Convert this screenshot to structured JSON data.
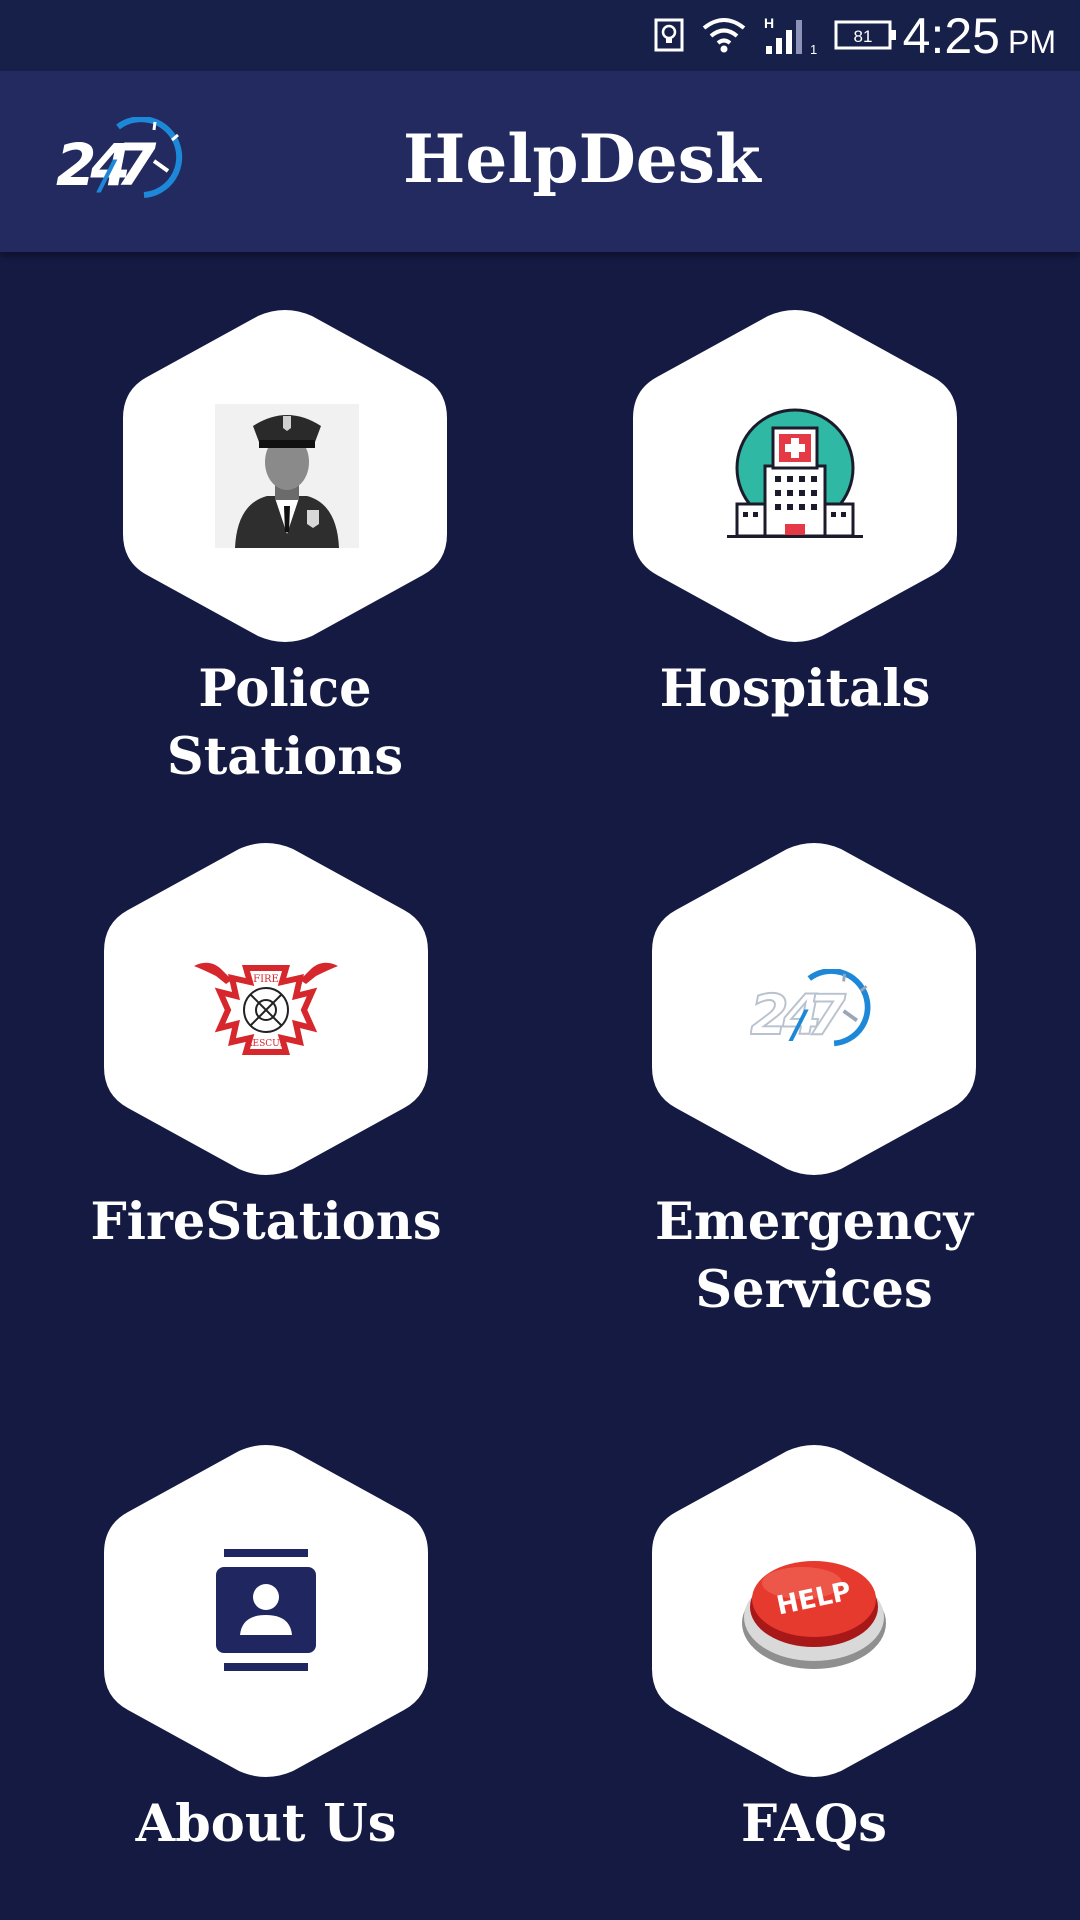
{
  "status_bar": {
    "time": "4:25",
    "ampm": "PM",
    "battery_level": "81",
    "network_type": "H",
    "sim_slot": "1",
    "icons": [
      "notification-icon",
      "wifi-icon",
      "signal-icon",
      "battery-icon"
    ]
  },
  "app_bar": {
    "title": "HelpDesk",
    "logo": "247-logo"
  },
  "tiles": [
    {
      "label": "Police Stations",
      "icon": "police-officer-icon"
    },
    {
      "label": "Hospitals",
      "icon": "hospital-icon"
    },
    {
      "label": "FireStations",
      "icon": "fire-rescue-icon"
    },
    {
      "label_lines": [
        "Emergency",
        "Services"
      ],
      "icon": "247-logo"
    },
    {
      "label": "About Us",
      "icon": "contact-card-icon"
    },
    {
      "label": "FAQs",
      "icon": "help-button-icon",
      "icon_text": "HELP"
    }
  ],
  "colors": {
    "background": "#141a42",
    "app_bar": "#222a5f",
    "status_bar": "#172049",
    "tile": "#ffffff",
    "text": "#ffffff",
    "accent_blue": "#1e88d8"
  }
}
